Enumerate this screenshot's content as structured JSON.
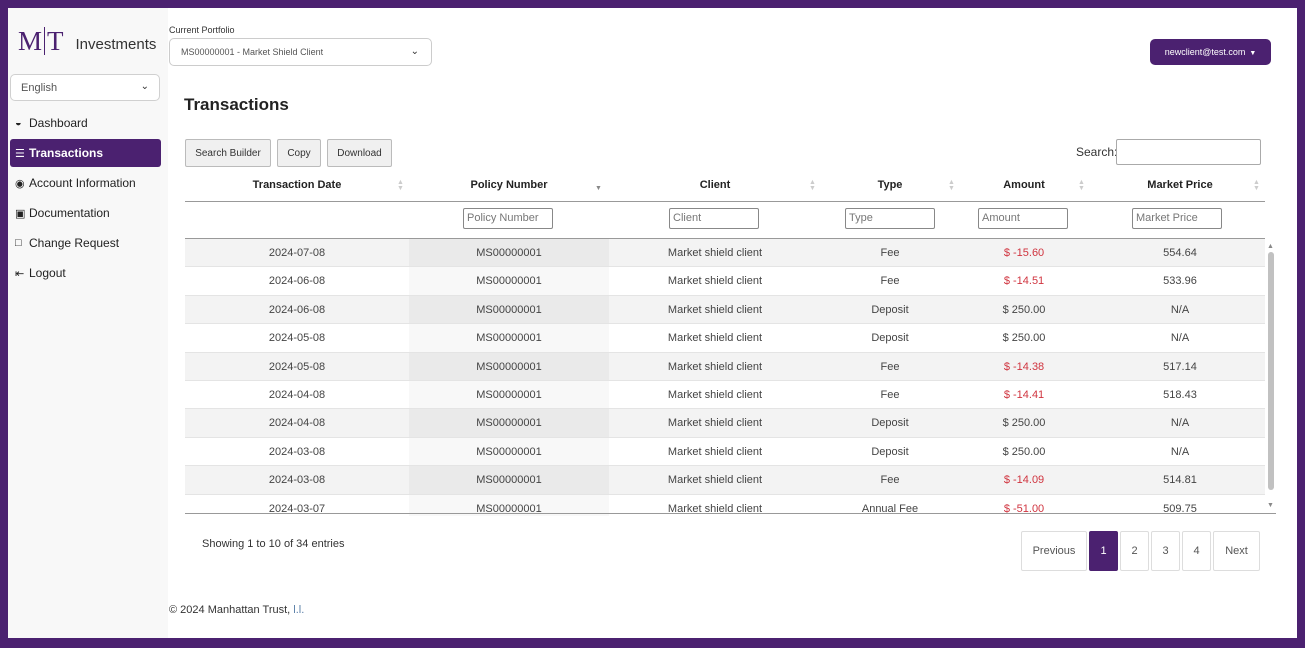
{
  "brand": {
    "logo_left": "M",
    "logo_right": "T",
    "name": "Investments"
  },
  "language": {
    "selected": "English"
  },
  "nav": [
    {
      "label": "Dashboard",
      "icon": "dashboard-icon"
    },
    {
      "label": "Transactions",
      "icon": "list-icon",
      "active": true
    },
    {
      "label": "Account Information",
      "icon": "user-circle-icon"
    },
    {
      "label": "Documentation",
      "icon": "document-icon"
    },
    {
      "label": "Change Request",
      "icon": "file-icon"
    },
    {
      "label": "Logout",
      "icon": "logout-icon"
    }
  ],
  "header": {
    "portfolio_label": "Current Portfolio",
    "portfolio_value": "MS00000001 - Market Shield Client",
    "user_email": "newclient@test.com"
  },
  "page": {
    "title": "Transactions"
  },
  "toolbar": {
    "search_builder": "Search Builder",
    "copy": "Copy",
    "download": "Download",
    "search_label": "Search:"
  },
  "table": {
    "columns": [
      "Transaction Date",
      "Policy Number",
      "Client",
      "Type",
      "Amount",
      "Market Price"
    ],
    "filters": [
      "Policy Number",
      "Client",
      "Type",
      "Amount",
      "Market Price"
    ],
    "rows": [
      [
        "2024-07-08",
        "MS00000001",
        "Market shield client",
        "Fee",
        "$ -15.60",
        "554.64"
      ],
      [
        "2024-06-08",
        "MS00000001",
        "Market shield client",
        "Fee",
        "$ -14.51",
        "533.96"
      ],
      [
        "2024-06-08",
        "MS00000001",
        "Market shield client",
        "Deposit",
        "$ 250.00",
        "N/A"
      ],
      [
        "2024-05-08",
        "MS00000001",
        "Market shield client",
        "Deposit",
        "$ 250.00",
        "N/A"
      ],
      [
        "2024-05-08",
        "MS00000001",
        "Market shield client",
        "Fee",
        "$ -14.38",
        "517.14"
      ],
      [
        "2024-04-08",
        "MS00000001",
        "Market shield client",
        "Fee",
        "$ -14.41",
        "518.43"
      ],
      [
        "2024-04-08",
        "MS00000001",
        "Market shield client",
        "Deposit",
        "$ 250.00",
        "N/A"
      ],
      [
        "2024-03-08",
        "MS00000001",
        "Market shield client",
        "Deposit",
        "$ 250.00",
        "N/A"
      ],
      [
        "2024-03-08",
        "MS00000001",
        "Market shield client",
        "Fee",
        "$ -14.09",
        "514.81"
      ],
      [
        "2024-03-07",
        "MS00000001",
        "Market shield client",
        "Annual Fee",
        "$ -51.00",
        "509.75"
      ]
    ]
  },
  "pagination": {
    "info": "Showing 1 to 10 of 34 entries",
    "previous": "Previous",
    "pages": [
      "1",
      "2",
      "3",
      "4"
    ],
    "current": "1",
    "next": "Next"
  },
  "footer": {
    "copyright": "© 2024 Manhattan Trust, ",
    "link": "l.l."
  },
  "colors": {
    "brand": "#4b2170",
    "negative": "#d0343f"
  }
}
